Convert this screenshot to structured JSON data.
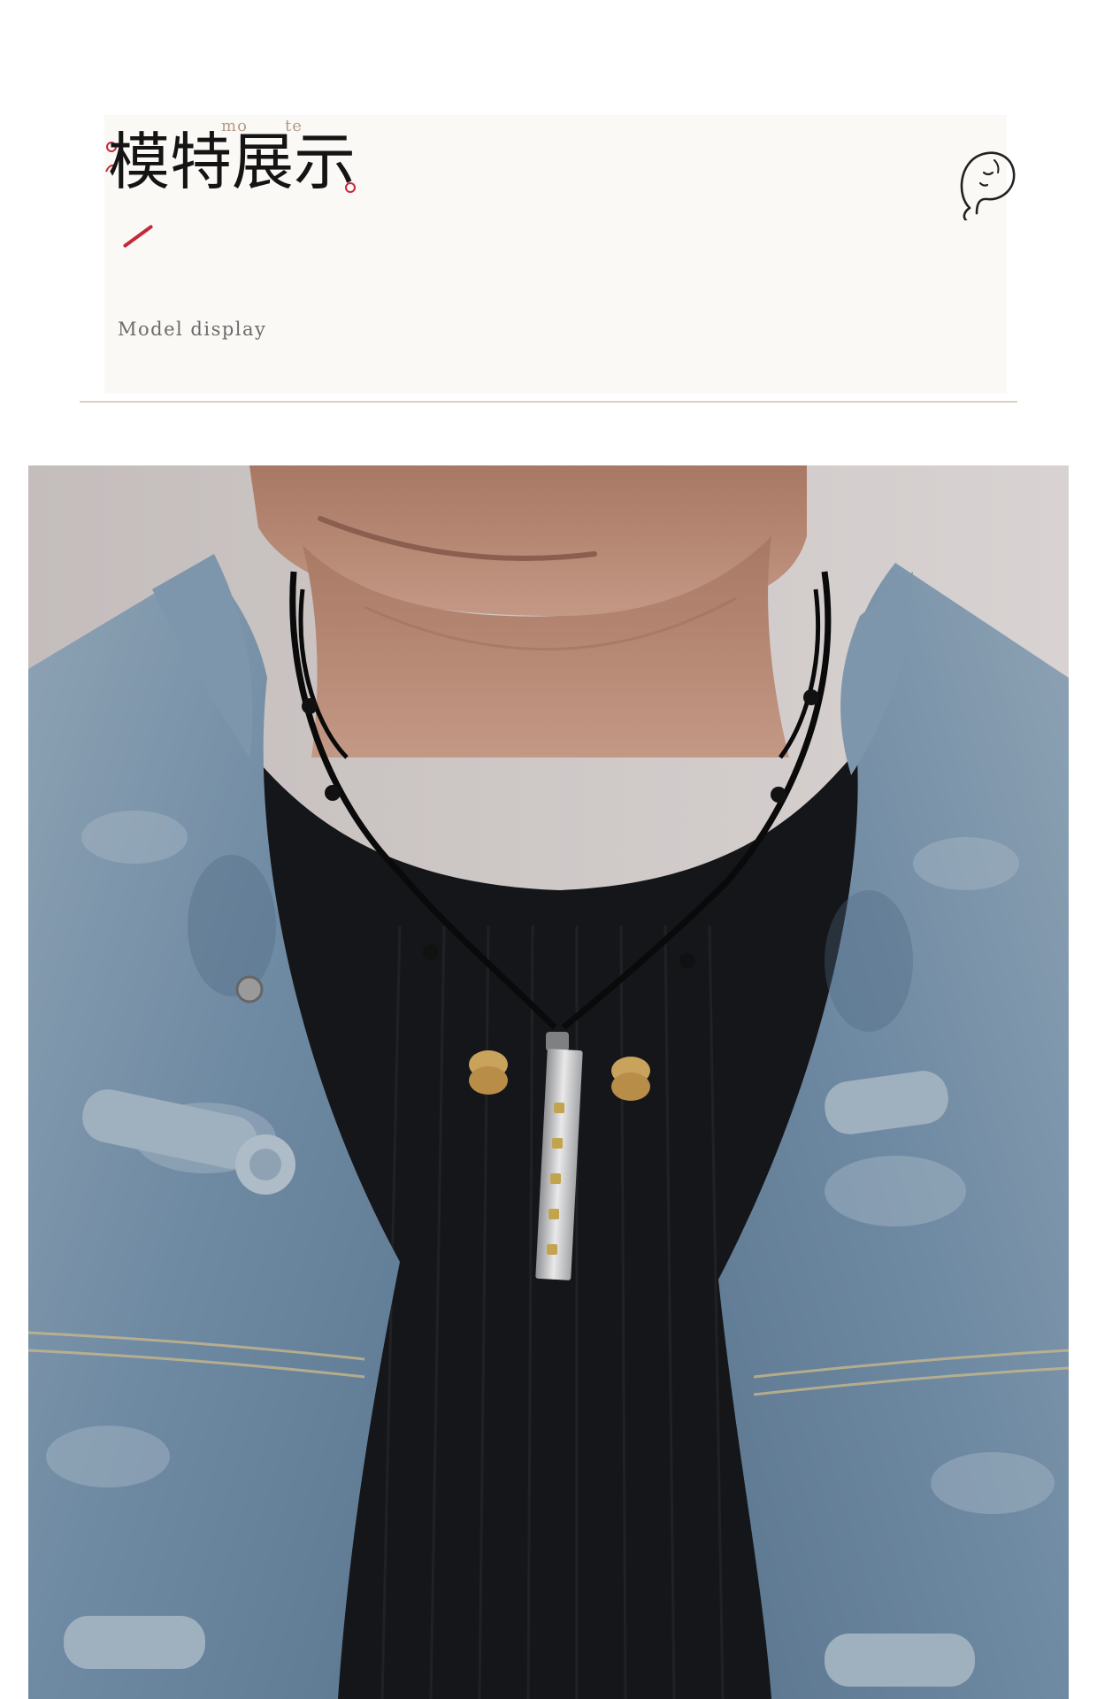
{
  "header": {
    "pinyin_mo": "mo",
    "pinyin_te": "te",
    "title_zh": "模特展示",
    "subtitle_en": "Model display"
  },
  "colors": {
    "accent_red": "#c22a3a",
    "title_text": "#141414",
    "pinyin": "#b59b86",
    "divider": "#d9d0bf",
    "denim": "#6f8aa3",
    "shirt": "#15161a"
  },
  "icons": {
    "mascot": "sleepy-face-icon"
  },
  "photo": {
    "subject": "model-wearing-pendant-necklace"
  }
}
